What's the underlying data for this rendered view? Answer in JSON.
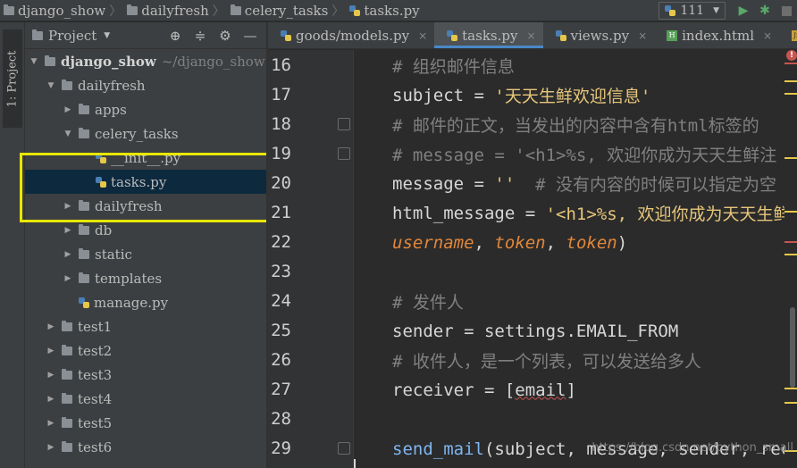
{
  "navbar": {
    "breadcrumbs": [
      "django_show",
      "dailyfresh",
      "celery_tasks",
      "tasks.py"
    ],
    "run_config": "111"
  },
  "left_strip": {
    "tab_label": "1: Project"
  },
  "project_panel": {
    "title": "Project",
    "tree": [
      {
        "label": "django_show",
        "note": "~/django_show",
        "level": 0,
        "type": "folder",
        "expanded": true,
        "bold": true
      },
      {
        "label": "dailyfresh",
        "level": 1,
        "type": "folder",
        "expanded": true
      },
      {
        "label": "apps",
        "level": 2,
        "type": "folder",
        "expanded": false
      },
      {
        "label": "celery_tasks",
        "level": 2,
        "type": "folder",
        "expanded": true
      },
      {
        "label": "__init__.py",
        "level": 3,
        "type": "py"
      },
      {
        "label": "tasks.py",
        "level": 3,
        "type": "py",
        "selected": true
      },
      {
        "label": "dailyfresh",
        "level": 2,
        "type": "folder",
        "expanded": false
      },
      {
        "label": "db",
        "level": 2,
        "type": "folder",
        "expanded": false
      },
      {
        "label": "static",
        "level": 2,
        "type": "folder",
        "expanded": false
      },
      {
        "label": "templates",
        "level": 2,
        "type": "folder",
        "expanded": false
      },
      {
        "label": "manage.py",
        "level": 2,
        "type": "py"
      },
      {
        "label": "test1",
        "level": 1,
        "type": "folder",
        "expanded": false
      },
      {
        "label": "test2",
        "level": 1,
        "type": "folder",
        "expanded": false
      },
      {
        "label": "test3",
        "level": 1,
        "type": "folder",
        "expanded": false
      },
      {
        "label": "test4",
        "level": 1,
        "type": "folder",
        "expanded": false
      },
      {
        "label": "test5",
        "level": 1,
        "type": "folder",
        "expanded": false
      },
      {
        "label": "test6",
        "level": 1,
        "type": "folder",
        "expanded": false
      }
    ]
  },
  "editor_tabs": [
    {
      "label": "goods/models.py",
      "icon": "python-file-icon",
      "active": false
    },
    {
      "label": "tasks.py",
      "icon": "python-file-icon",
      "active": true
    },
    {
      "label": "views.py",
      "icon": "python-file-icon",
      "active": false
    },
    {
      "label": "index.html",
      "icon": "html-file-icon",
      "active": false
    }
  ],
  "editor": {
    "lines": [
      {
        "num": "16",
        "tokens": [
          [
            "com",
            "# 组织邮件信息"
          ]
        ]
      },
      {
        "num": "17",
        "tokens": [
          [
            "var",
            "subject "
          ],
          [
            "op",
            "= "
          ],
          [
            "str",
            "'天天生鲜欢迎信息'"
          ]
        ]
      },
      {
        "num": "18",
        "tokens": [
          [
            "com",
            "# 邮件的正文，当发出的内容中含有html标签的"
          ]
        ]
      },
      {
        "num": "19",
        "tokens": [
          [
            "com",
            "# message = '<h1>%s, 欢迎你成为天天生鲜注"
          ]
        ]
      },
      {
        "num": "20",
        "tokens": [
          [
            "var",
            "message "
          ],
          [
            "op",
            "= "
          ],
          [
            "str",
            "''"
          ],
          [
            "com",
            "  # 没有内容的时候可以指定为空"
          ]
        ]
      },
      {
        "num": "21",
        "tokens": [
          [
            "var",
            "html_message "
          ],
          [
            "op",
            "= "
          ],
          [
            "str",
            "'<h1>%s, 欢迎你成为天天生鲜"
          ]
        ]
      },
      {
        "num": "22",
        "tokens": [
          [
            "it",
            "username"
          ],
          [
            "op",
            ", "
          ],
          [
            "it",
            "token"
          ],
          [
            "op",
            ", "
          ],
          [
            "it",
            "token"
          ],
          [
            "op",
            ")"
          ]
        ]
      },
      {
        "num": "23",
        "tokens": []
      },
      {
        "num": "24",
        "tokens": [
          [
            "com",
            "# 发件人"
          ]
        ]
      },
      {
        "num": "25",
        "tokens": [
          [
            "var",
            "sender "
          ],
          [
            "op",
            "= "
          ],
          [
            "var",
            "settings.EMAIL_FROM"
          ]
        ]
      },
      {
        "num": "26",
        "tokens": [
          [
            "com",
            "# 收件人，是一个列表，可以发送给多人"
          ]
        ]
      },
      {
        "num": "27",
        "tokens": [
          [
            "var",
            "receiver "
          ],
          [
            "op",
            "= "
          ],
          [
            "op",
            "["
          ],
          [
            "wavy",
            "email"
          ],
          [
            "op",
            "]"
          ]
        ]
      },
      {
        "num": "28",
        "tokens": []
      },
      {
        "num": "29",
        "tokens": [
          [
            "fn",
            "send_mail"
          ],
          [
            "op",
            "(subject, message, sender, recei"
          ]
        ]
      }
    ]
  },
  "watermark": "https://blog.csdn.net/python_small",
  "colors": {
    "highlight_box": "#e8e800",
    "error_marker": "#c75450",
    "warning_marker": "#e6c74a",
    "selection": "#0d293e"
  }
}
